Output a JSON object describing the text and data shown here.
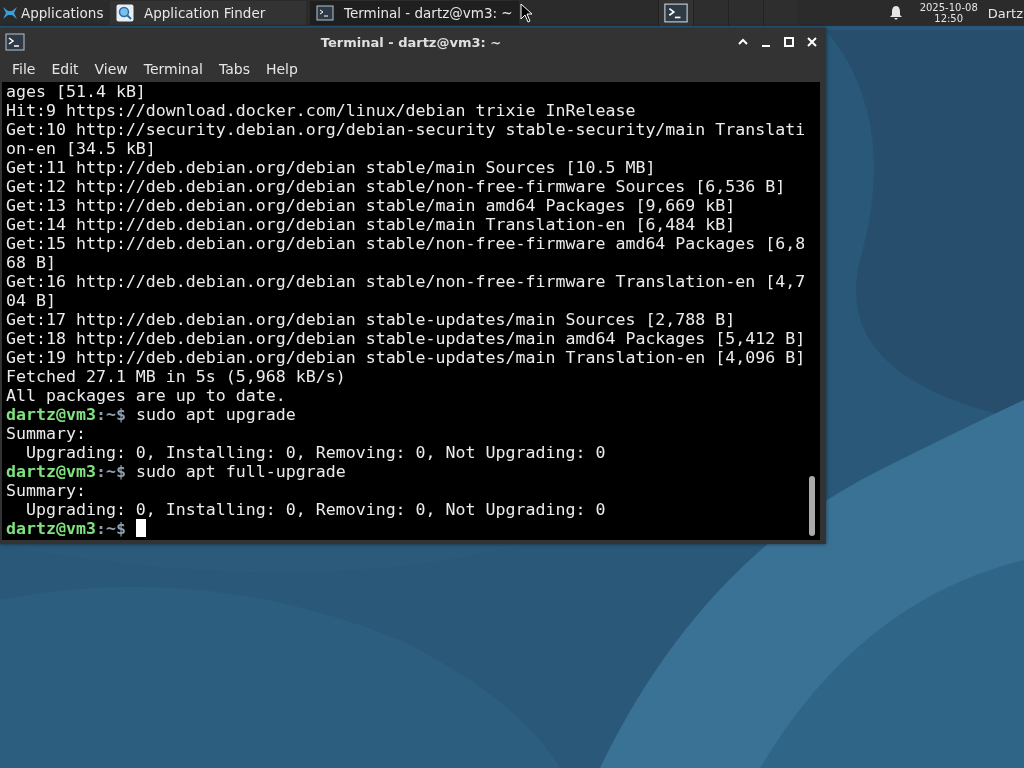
{
  "panel": {
    "menu_label": "Applications",
    "tasks": [
      {
        "label": "Application Finder",
        "selected": false
      },
      {
        "label": "Terminal - dartz@vm3: ~",
        "selected": true
      }
    ],
    "clock": {
      "date": "2025-10-08",
      "time": "12:50"
    },
    "user": "Dartz"
  },
  "window": {
    "title": "Terminal - dartz@vm3: ~",
    "menu": [
      "File",
      "Edit",
      "View",
      "Terminal",
      "Tabs",
      "Help"
    ],
    "lines": [
      {
        "kind": "output",
        "text": "ages [51.4 kB]"
      },
      {
        "kind": "output",
        "text": "Hit:9 https://download.docker.com/linux/debian trixie InRelease"
      },
      {
        "kind": "output",
        "text": "Get:10 http://security.debian.org/debian-security stable-security/main Translati"
      },
      {
        "kind": "output",
        "text": "on-en [34.5 kB]"
      },
      {
        "kind": "output",
        "text": "Get:11 http://deb.debian.org/debian stable/main Sources [10.5 MB]"
      },
      {
        "kind": "output",
        "text": "Get:12 http://deb.debian.org/debian stable/non-free-firmware Sources [6,536 B]"
      },
      {
        "kind": "output",
        "text": "Get:13 http://deb.debian.org/debian stable/main amd64 Packages [9,669 kB]"
      },
      {
        "kind": "output",
        "text": "Get:14 http://deb.debian.org/debian stable/main Translation-en [6,484 kB]"
      },
      {
        "kind": "output",
        "text": "Get:15 http://deb.debian.org/debian stable/non-free-firmware amd64 Packages [6,8"
      },
      {
        "kind": "output",
        "text": "68 B]"
      },
      {
        "kind": "output",
        "text": "Get:16 http://deb.debian.org/debian stable/non-free-firmware Translation-en [4,7"
      },
      {
        "kind": "output",
        "text": "04 B]"
      },
      {
        "kind": "output",
        "text": "Get:17 http://deb.debian.org/debian stable-updates/main Sources [2,788 B]"
      },
      {
        "kind": "output",
        "text": "Get:18 http://deb.debian.org/debian stable-updates/main amd64 Packages [5,412 B]"
      },
      {
        "kind": "output",
        "text": "Get:19 http://deb.debian.org/debian stable-updates/main Translation-en [4,096 B]"
      },
      {
        "kind": "output",
        "text": "Fetched 27.1 MB in 5s (5,968 kB/s)"
      },
      {
        "kind": "output",
        "text": "All packages are up to date."
      },
      {
        "kind": "prompt",
        "user": "dartz@vm3",
        "path": ":~$",
        "command": "sudo apt upgrade",
        "cursor": false
      },
      {
        "kind": "output",
        "text": "Summary:"
      },
      {
        "kind": "output",
        "text": "  Upgrading: 0, Installing: 0, Removing: 0, Not Upgrading: 0"
      },
      {
        "kind": "prompt",
        "user": "dartz@vm3",
        "path": ":~$",
        "command": "sudo apt full-upgrade",
        "cursor": false
      },
      {
        "kind": "output",
        "text": "Summary:"
      },
      {
        "kind": "output",
        "text": "  Upgrading: 0, Installing: 0, Removing: 0, Not Upgrading: 0"
      },
      {
        "kind": "prompt",
        "user": "dartz@vm3",
        "path": ":~$",
        "cursor": true
      }
    ]
  }
}
